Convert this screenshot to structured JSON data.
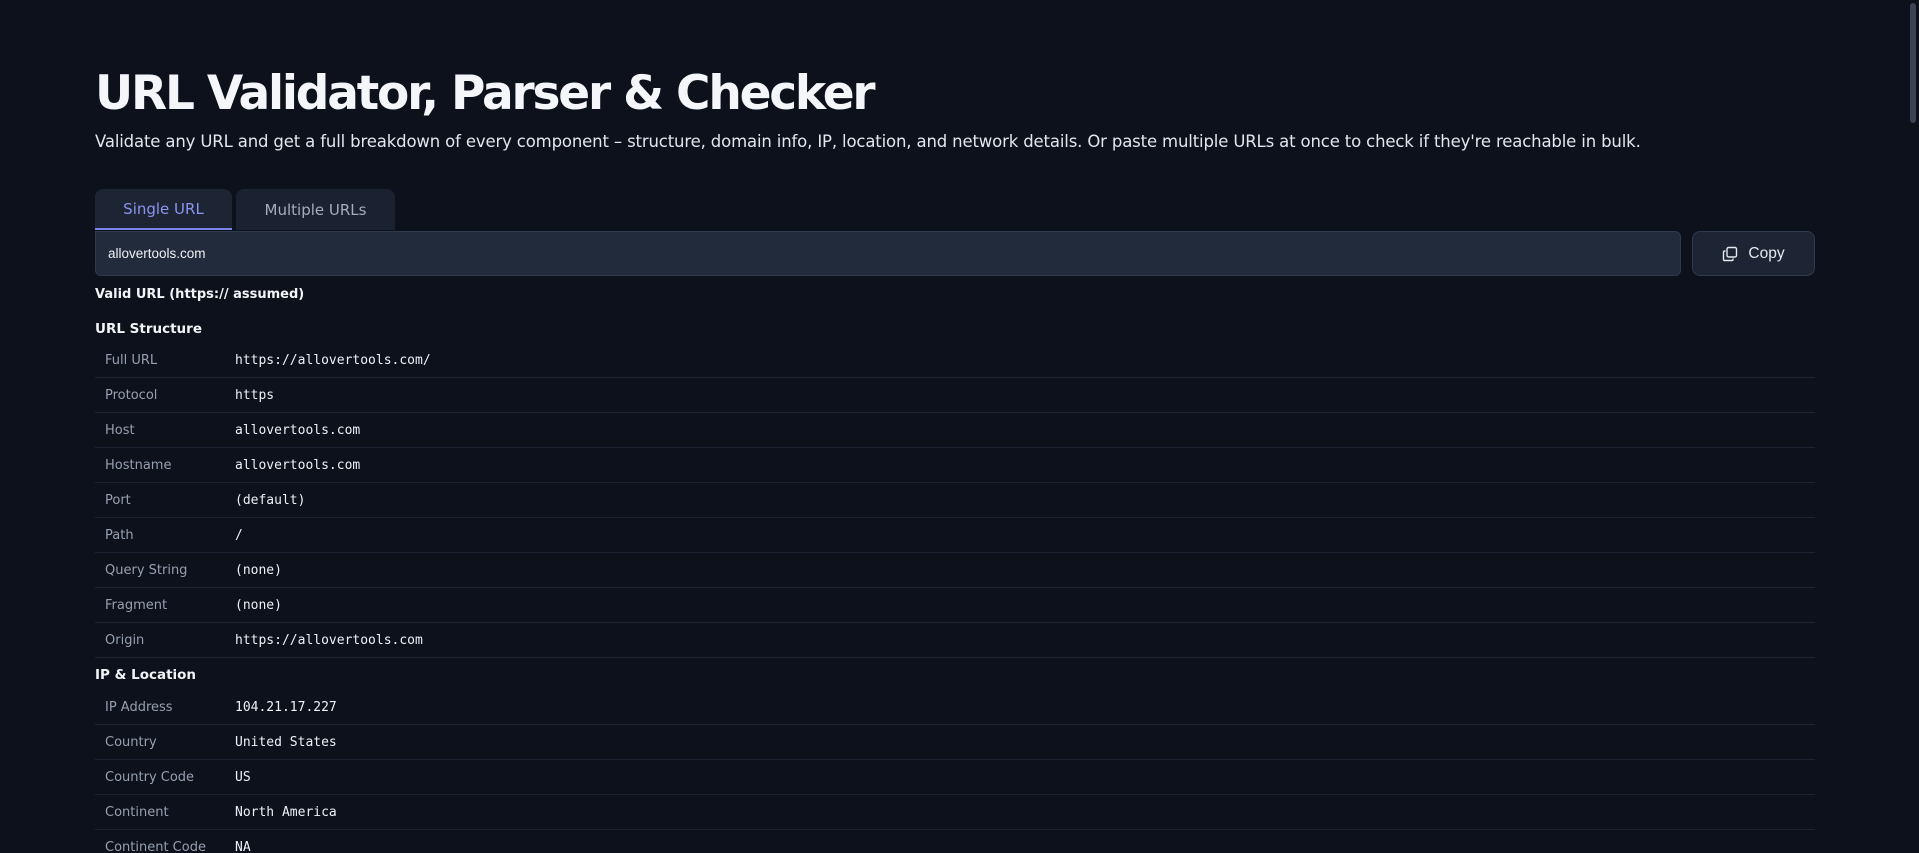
{
  "header": {
    "title": "URL Validator, Parser & Checker",
    "subtitle": "Validate any URL and get a full breakdown of every component – structure, domain info, IP, location, and network details. Or paste multiple URLs at once to check if they're reachable in bulk."
  },
  "tabs": [
    {
      "label": "Single URL",
      "active": true
    },
    {
      "label": "Multiple URLs",
      "active": false
    }
  ],
  "input": {
    "value": "allovertools.com",
    "placeholder": ""
  },
  "copy_button": {
    "label": "Copy",
    "icon": "copy-icon"
  },
  "status": "Valid URL (https:// assumed)",
  "sections": {
    "structure": {
      "title": "URL Structure",
      "rows": [
        {
          "key": "Full URL",
          "value": "https://allovertools.com/"
        },
        {
          "key": "Protocol",
          "value": "https"
        },
        {
          "key": "Host",
          "value": "allovertools.com"
        },
        {
          "key": "Hostname",
          "value": "allovertools.com"
        },
        {
          "key": "Port",
          "value": "(default)"
        },
        {
          "key": "Path",
          "value": "/"
        },
        {
          "key": "Query String",
          "value": "(none)"
        },
        {
          "key": "Fragment",
          "value": "(none)"
        },
        {
          "key": "Origin",
          "value": "https://allovertools.com"
        }
      ]
    },
    "ip_location": {
      "title": "IP & Location",
      "rows": [
        {
          "key": "IP Address",
          "value": "104.21.17.227"
        },
        {
          "key": "Country",
          "value": "United States"
        },
        {
          "key": "Country Code",
          "value": "US"
        },
        {
          "key": "Continent",
          "value": "North America"
        },
        {
          "key": "Continent Code",
          "value": "NA"
        }
      ]
    }
  },
  "colors": {
    "background": "#0c111b",
    "accent": "#8b93f0",
    "panel": "#222b3c"
  }
}
